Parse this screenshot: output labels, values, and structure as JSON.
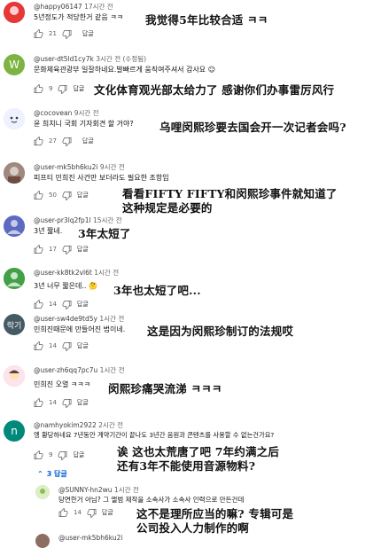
{
  "comments": [
    {
      "user": "@happy06147",
      "time": "17시간 전",
      "text": "5년정도가 적당한거 같음 ㅋㅋ",
      "likes": "21",
      "reply": "답글",
      "translation": "我觉得5年比较合适 ㅋㅋ",
      "avatar_color": "#e03131"
    },
    {
      "user": "@user-dt5ld1cy7k",
      "time": "3시간 전 (수정됨)",
      "text": "문화체육관광부 일잘하네요.발빠르게 움직여주셔서 감사요",
      "likes": "9",
      "reply": "답글",
      "translation": "文化体育观光部太给力了 感谢你们办事雷厉风行",
      "avatar_letter": "W",
      "avatar_color": "#7cb342"
    },
    {
      "user": "@cocovean",
      "time": "9시간 전",
      "text": "윤 희치니 국회 기자회견 할 거야?",
      "likes": "27",
      "reply": "답글",
      "translation": "乌哩闵熙珍要去国会开一次记者会吗?",
      "avatar_color": "#dfe6ff"
    },
    {
      "user": "@user-mk5bh6ku2i",
      "time": "9시간 전",
      "text": "피프티 민희진 사건만 보더라도 필요한 조항임",
      "likes": "50",
      "reply": "답글",
      "translation_lines": [
        "看看FIFTY FIFTY和闵熙珍事件就知道了",
        "这种规定是必要的"
      ],
      "avatar_color": "#8d6e63"
    },
    {
      "user": "@user-pr3lq2fp1l",
      "time": "15시간 전",
      "text": "3년 짧네.",
      "likes": "17",
      "reply": "답글",
      "translation": "3年太短了",
      "avatar_color": "#5c6bc0"
    },
    {
      "user": "@user-kk8tk2vl6t",
      "time": "1시간 전",
      "text": "3년 너무 짧은데..",
      "likes": "14",
      "reply": "답글",
      "translation": "3年也太短了吧...",
      "avatar_color": "#43a047"
    },
    {
      "user": "@user-sw4de9td5y",
      "time": "1시간 전",
      "text": "민희진때문에 만들어진 법이네.",
      "likes": "14",
      "reply": "답글",
      "translation": "这是因为闵熙珍制订的法规哎",
      "avatar_letter": "락기",
      "avatar_color": "#455a64"
    },
    {
      "user": "@user-zh6qq7pc7u",
      "time": "1시간 전",
      "text": "민희진 오열 ㅋㅋㅋ",
      "likes": "14",
      "reply": "답글",
      "translation": "闵熙珍痛哭流涕 ㅋㅋㅋ",
      "avatar_color": "#f8bbd0"
    },
    {
      "user": "@namhyokim2922",
      "time": "2시간 전",
      "text": "엥 황당하네요 7년동안 계약기간이 끝나도 3년간 음원과 콘텐츠를 사용할 수 없는건가요?",
      "likes": "9",
      "reply": "답글",
      "translation_lines": [
        "诶 这也太荒唐了吧 7年约满之后",
        "还有3年不能使用音源物料?"
      ],
      "avatar_letter": "n",
      "avatar_color": "#00897b"
    }
  ],
  "replies_toggle": "3 답글",
  "reply_comment": {
    "user": "@SUNNY-hn2wu",
    "time": "1시간 전",
    "text": "당연한거 아님? 그 앨범 제작을 소속사가 소속사 인력으로 만든건데",
    "likes": "14",
    "reply": "답글",
    "translation_lines": [
      "这不是理所应当的嘛? 专辑可是",
      "公司投入人力制作的啊"
    ]
  },
  "next_user": "@user-mk5bh6ku2i"
}
